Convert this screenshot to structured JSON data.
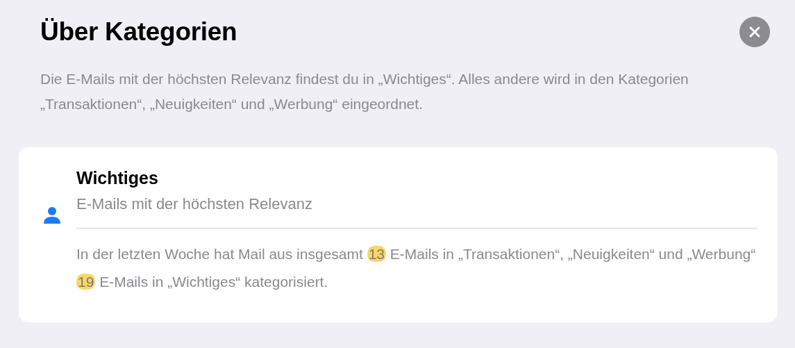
{
  "title": "Über Kategorien",
  "description": "Die E-Mails mit der höchsten Relevanz findest du in „Wichtiges“. Alles andere wird in den Kategorien „Transaktionen“, „Neuigkeiten“ und „Werbung“ eingeordnet.",
  "category": {
    "name": "Wichtiges",
    "subtitle": "E-Mails mit der höchsten Relevanz",
    "summary": [
      {
        "text": "In der letzten Woche hat Mail aus insgesamt ",
        "highlighted": false
      },
      {
        "text": "13",
        "highlighted": true
      },
      {
        "text": " E-Mails in „Transaktionen“, „Neuigkeiten“ und „Werbung“ ",
        "highlighted": false
      },
      {
        "text": "19",
        "highlighted": true
      },
      {
        "text": " E-Mails in „Wichtiges“ kategorisiert.",
        "highlighted": false
      }
    ]
  }
}
